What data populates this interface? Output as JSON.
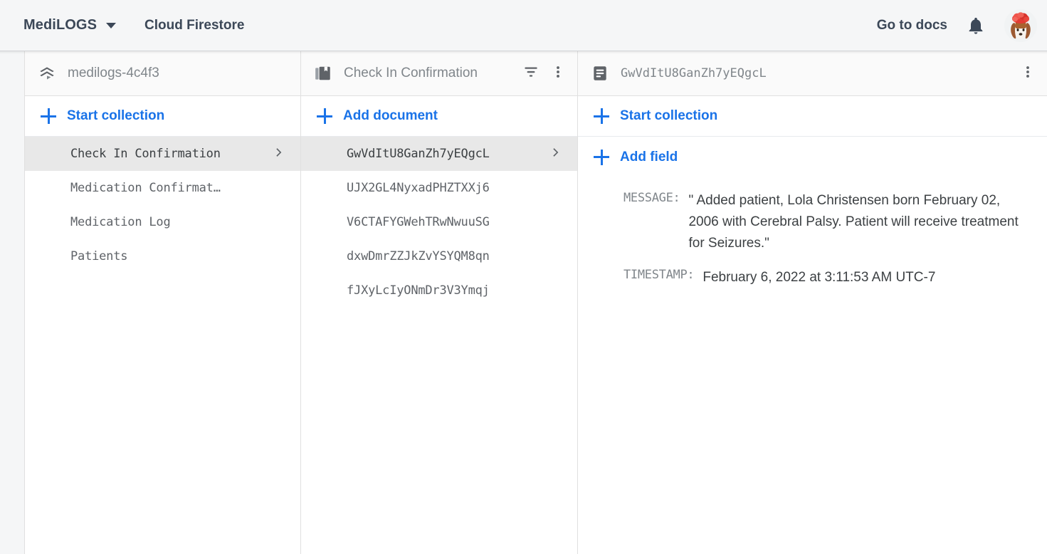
{
  "topbar": {
    "brand": "MediLOGS",
    "brand_caret_icon": "chevron-down-icon",
    "product": "Cloud Firestore",
    "docs_link": "Go to docs",
    "notifications_icon": "bell-icon",
    "avatar_icon": "user-avatar"
  },
  "colors": {
    "accent_blue": "#1a73e8",
    "topbar_bg": "#f5f6f7",
    "panel_header_bg": "#fafafa",
    "selected_row_bg": "#e8e8e8",
    "text_primary": "#3c4043",
    "text_secondary": "#5f6368",
    "text_muted": "#80868b",
    "border": "#e0e0e0"
  },
  "panels": {
    "collections": {
      "icon": "firestore-stack-icon",
      "title": "medilogs-4c4f3",
      "action": "Start collection",
      "action_icon": "plus-icon",
      "items": [
        {
          "label": "Check In Confirmation",
          "selected": true
        },
        {
          "label": "Medication Confirmat…",
          "selected": false
        },
        {
          "label": "Medication Log",
          "selected": false
        },
        {
          "label": "Patients",
          "selected": false
        }
      ]
    },
    "documents": {
      "icon": "collection-icon",
      "title": "Check In Confirmation",
      "filter_icon": "filter-icon",
      "menu_icon": "more-vert-icon",
      "action": "Add document",
      "action_icon": "plus-icon",
      "items": [
        {
          "label": "GwVdItU8GanZh7yEQgcL",
          "selected": true
        },
        {
          "label": "UJX2GL4NyxadPHZTXXj6",
          "selected": false
        },
        {
          "label": "V6CTAFYGWehTRwNwuuSG",
          "selected": false
        },
        {
          "label": "dxwDmrZZJkZvYSYQM8qn",
          "selected": false
        },
        {
          "label": "fJXyLcIyONmDr3V3Ymqj",
          "selected": false
        }
      ]
    },
    "fields": {
      "icon": "document-icon",
      "title": "GwVdItU8GanZh7yEQgcL",
      "menu_icon": "more-vert-icon",
      "action_start_collection": "Start collection",
      "action_add_field": "Add field",
      "action_icon": "plus-icon",
      "rows": [
        {
          "key": "MESSAGE:",
          "value": "\" Added patient, Lola Christensen born February 02, 2006 with Cerebral Palsy. Patient will receive treatment for Seizures.\""
        },
        {
          "key": "TIMESTAMP:",
          "value": "February 6, 2022 at 3:11:53 AM UTC-7"
        }
      ]
    }
  }
}
